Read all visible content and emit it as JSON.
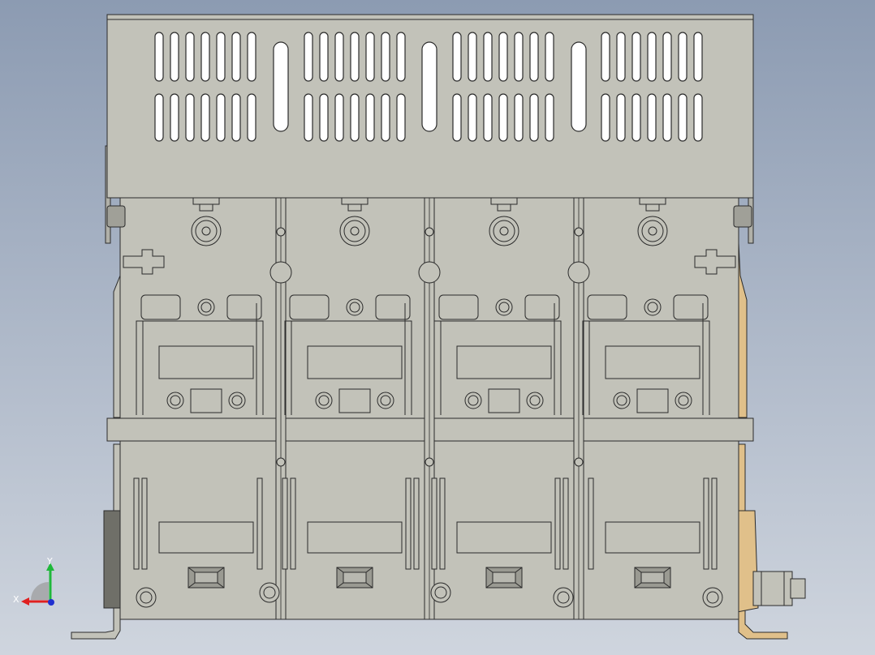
{
  "viewport": {
    "background_top": "#8c9bb2",
    "background_bottom": "#cfd5de"
  },
  "model": {
    "body_color": "#c2c2b9",
    "edge_color": "#2b2b2b",
    "terminal_color": "#e0c08a",
    "hole_color": "#ffffff",
    "pole_count": 4
  },
  "triad": {
    "x_label": "X",
    "y_label": "Y",
    "x_color": "#e02020",
    "y_color": "#1fb83a",
    "z_color": "#2030d0"
  }
}
